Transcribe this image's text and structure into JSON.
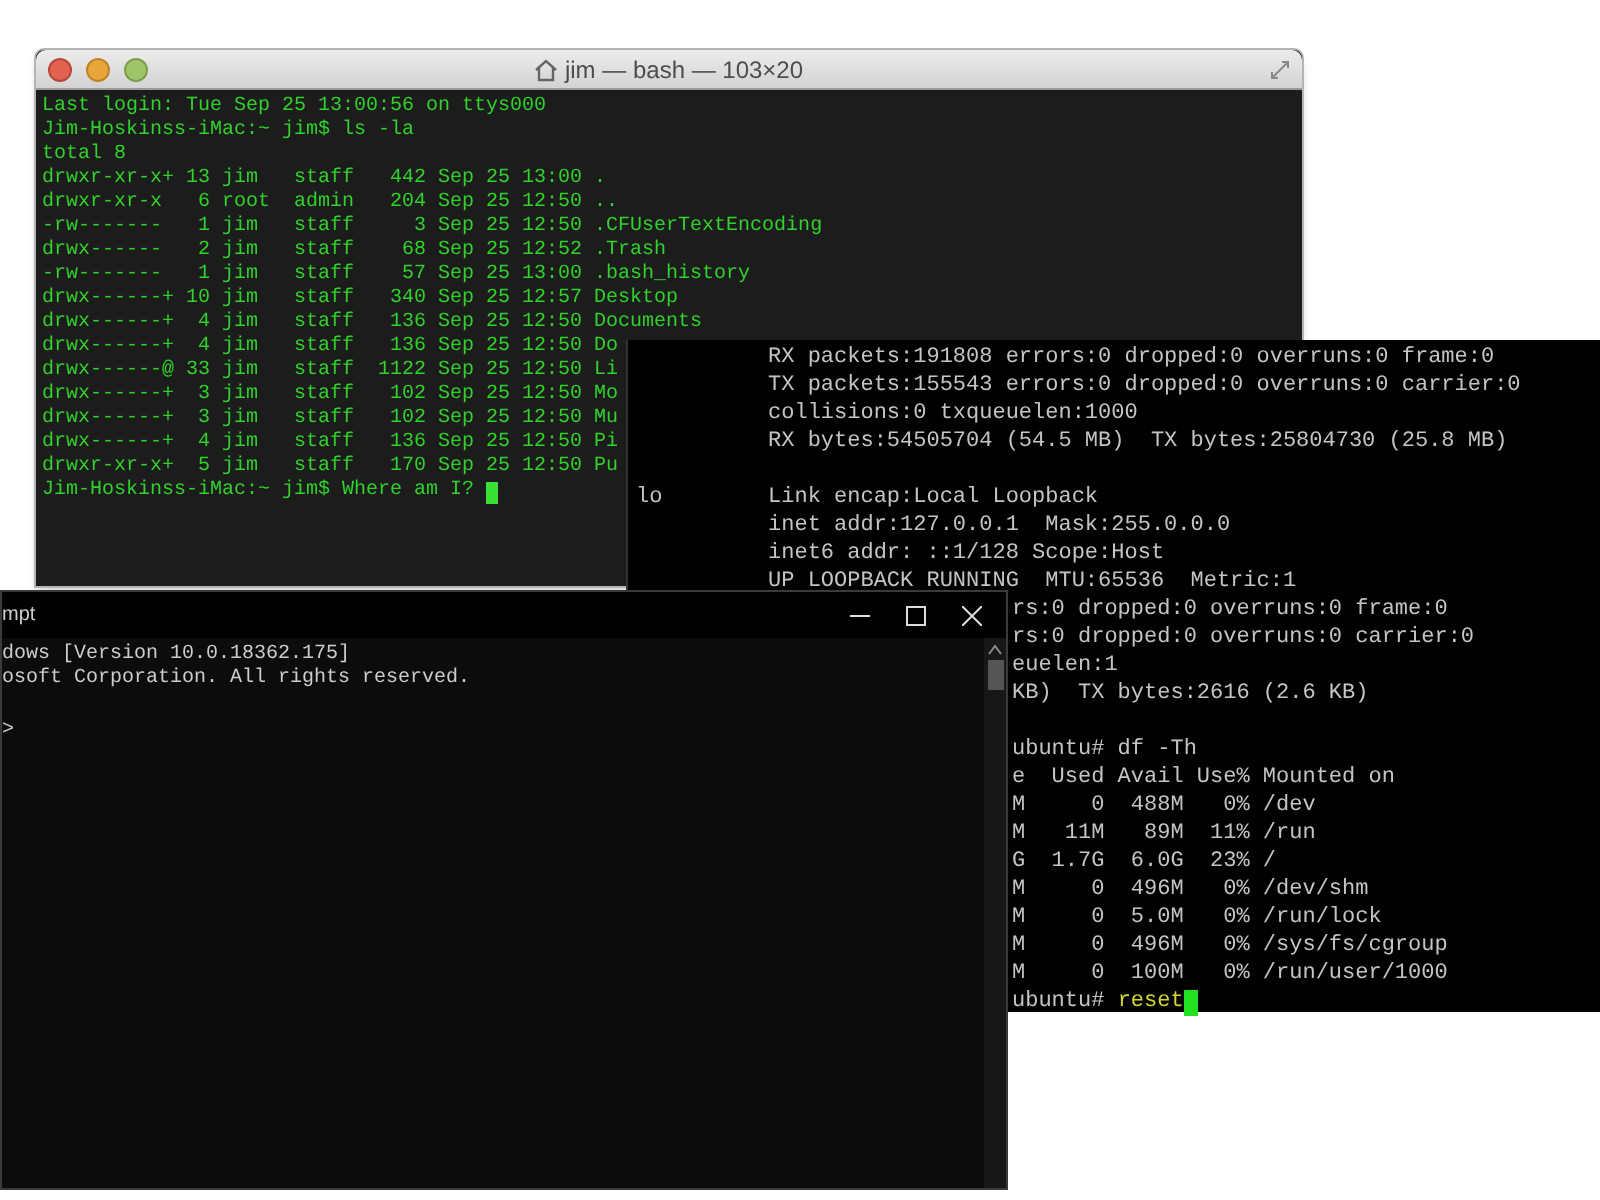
{
  "mac_terminal": {
    "title": "jim — bash — 103×20",
    "cursor": true,
    "lines": [
      "Last login: Tue Sep 25 13:00:56 on ttys000",
      "Jim-Hoskinss-iMac:~ jim$ ls -la",
      "total 8",
      "drwxr-xr-x+ 13 jim   staff   442 Sep 25 13:00 .",
      "drwxr-xr-x   6 root  admin   204 Sep 25 12:50 ..",
      "-rw-------   1 jim   staff     3 Sep 25 12:50 .CFUserTextEncoding",
      "drwx------   2 jim   staff    68 Sep 25 12:52 .Trash",
      "-rw-------   1 jim   staff    57 Sep 25 13:00 .bash_history",
      "drwx------+ 10 jim   staff   340 Sep 25 12:57 Desktop",
      "drwx------+  4 jim   staff   136 Sep 25 12:50 Documents",
      "drwx------+  4 jim   staff   136 Sep 25 12:50 Do",
      "drwx------@ 33 jim   staff  1122 Sep 25 12:50 Li",
      "drwx------+  3 jim   staff   102 Sep 25 12:50 Mo",
      "drwx------+  3 jim   staff   102 Sep 25 12:50 Mu",
      "drwx------+  4 jim   staff   136 Sep 25 12:50 Pi",
      "drwxr-xr-x+  5 jim   staff   170 Sep 25 12:50 Pu",
      "Jim-Hoskinss-iMac:~ jim$ Where am I? "
    ]
  },
  "linux_terminal": {
    "cursor": true,
    "lines": [
      {
        "kind": "full",
        "text": "          RX packets:191808 errors:0 dropped:0 overruns:0 frame:0"
      },
      {
        "kind": "full",
        "text": "          TX packets:155543 errors:0 dropped:0 overruns:0 carrier:0"
      },
      {
        "kind": "full",
        "text": "          collisions:0 txqueuelen:1000"
      },
      {
        "kind": "full",
        "text": "          RX bytes:54505704 (54.5 MB)  TX bytes:25804730 (25.8 MB)"
      },
      {
        "kind": "blank"
      },
      {
        "kind": "full",
        "text": "lo        Link encap:Local Loopback"
      },
      {
        "kind": "full",
        "text": "          inet addr:127.0.0.1  Mask:255.0.0.0"
      },
      {
        "kind": "full",
        "text": "          inet6 addr: ::1/128 Scope:Host"
      },
      {
        "kind": "full",
        "text": "          UP LOOPBACK RUNNING  MTU:65536  Metric:1"
      },
      {
        "kind": "clipped",
        "text": "rs:0 dropped:0 overruns:0 frame:0"
      },
      {
        "kind": "clipped",
        "text": "rs:0 dropped:0 overruns:0 carrier:0"
      },
      {
        "kind": "clipped",
        "text": "euelen:1"
      },
      {
        "kind": "clipped",
        "text": "KB)  TX bytes:2616 (2.6 KB)"
      },
      {
        "kind": "blank"
      },
      {
        "kind": "clipped",
        "text": "ubuntu# df -Th"
      },
      {
        "kind": "clipped",
        "text": "e  Used Avail Use% Mounted on"
      },
      {
        "kind": "clipped",
        "text": "M     0  488M   0% /dev"
      },
      {
        "kind": "clipped",
        "text": "M   11M   89M  11% /run"
      },
      {
        "kind": "clipped",
        "text": "G  1.7G  6.0G  23% /"
      },
      {
        "kind": "clipped",
        "text": "M     0  496M   0% /dev/shm"
      },
      {
        "kind": "clipped",
        "text": "M     0  5.0M   0% /run/lock"
      },
      {
        "kind": "clipped",
        "text": "M     0  496M   0% /sys/fs/cgroup"
      },
      {
        "kind": "clipped",
        "text": "M     0  100M   0% /run/user/1000"
      }
    ],
    "prompt": "ubuntu# ",
    "command": "reset"
  },
  "windows_terminal": {
    "title": "mpt",
    "lines": [
      {
        "kind": "full",
        "text": "dows [Version 10.0.18362.175]"
      },
      {
        "kind": "full",
        "text": "osoft Corporation. All rights reserved."
      },
      {
        "kind": "blank"
      },
      {
        "kind": "full",
        "text": ">"
      }
    ]
  }
}
